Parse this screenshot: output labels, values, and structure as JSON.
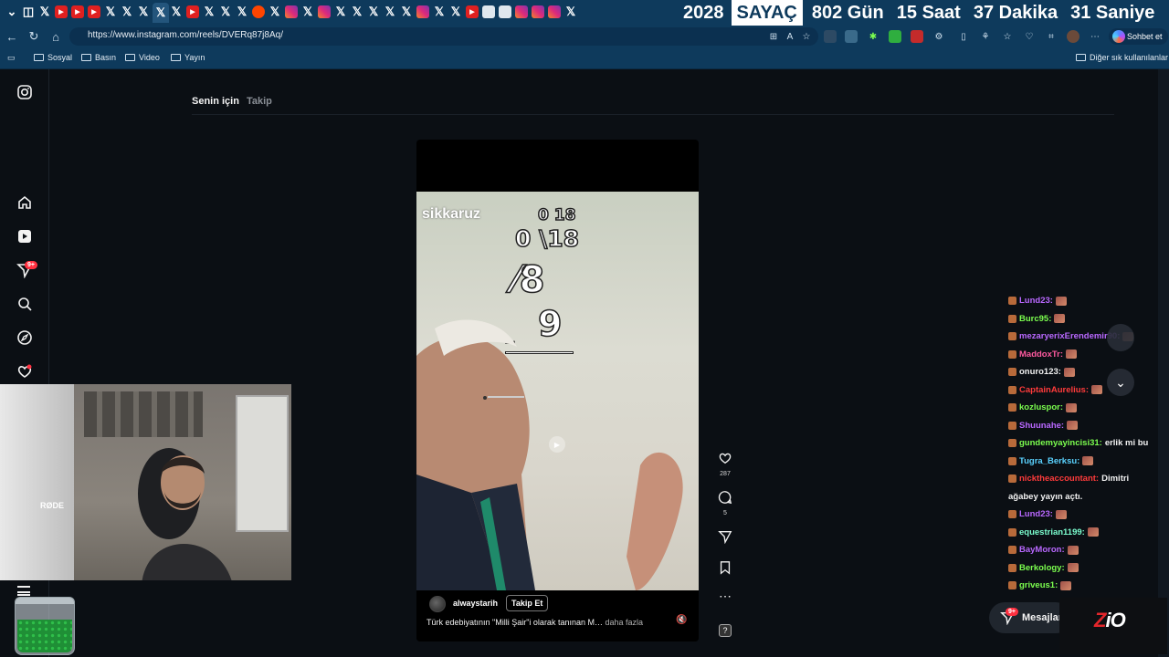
{
  "browser": {
    "tabs": [
      "chevron",
      "copilot",
      "x",
      "yt-alt",
      "yt",
      "yt",
      "x",
      "x",
      "x",
      "x-active",
      "x",
      "yt",
      "x",
      "x",
      "x",
      "reddit",
      "x",
      "ig",
      "x",
      "ig",
      "x",
      "x",
      "x",
      "x",
      "x",
      "ig",
      "x",
      "x",
      "yt",
      "doc",
      "doc",
      "ig",
      "ig",
      "ig",
      "x"
    ],
    "url": "https://www.instagram.com/reels/DVERq87j8Aq/",
    "copilot_label": "Sohbet et",
    "bookmarks": [
      "Sosyal",
      "Basın",
      "Video",
      "Yayın"
    ],
    "other_bookmarks": "Diğer sık kullanılanlar"
  },
  "counter": {
    "year": "2028",
    "title": "SAYAÇ",
    "days": "802 Gün",
    "hours": "15 Saat",
    "minutes": "37 Dakika",
    "seconds": "31 Saniye"
  },
  "instagram": {
    "feed_tabs": {
      "for_you": "Senin için",
      "following": "Takip"
    },
    "nav_badge": "9+",
    "reel": {
      "watermark": "sikkaruz",
      "overlay_lines": [
        "0 18",
        "0 \\18",
        "⁄8",
        "9",
        "_"
      ],
      "username": "alwaystarih",
      "follow_label": "Takip Et",
      "caption": "Türk edebiyatının \"Milli Şair\"i olarak tanınan M…",
      "more_label": "daha fazla",
      "likes": "287",
      "comments": "5"
    },
    "messages_label": "Mesajlar",
    "messages_badge": "9+"
  },
  "stream": {
    "cam_brand": "RØDE",
    "logo": {
      "z": "Z",
      "rest": "iO"
    }
  },
  "chat": [
    {
      "user": "Lund23:",
      "color": "#b968ff",
      "msg": ""
    },
    {
      "user": "Burc95:",
      "color": "#7cff4f",
      "msg": ""
    },
    {
      "user": "mezaryerixErendemir90:",
      "color": "#b968ff",
      "msg": ""
    },
    {
      "user": "MaddoxTr:",
      "color": "#ff5aa0",
      "msg": ""
    },
    {
      "user": "onuro123:",
      "color": "#f2f2f2",
      "msg": ""
    },
    {
      "user": "CaptainAurelius:",
      "color": "#ff3b3b",
      "msg": ""
    },
    {
      "user": "kozluspor:",
      "color": "#7cff4f",
      "msg": ""
    },
    {
      "user": "Shuunahe:",
      "color": "#b968ff",
      "msg": ""
    },
    {
      "user": "gundemyayincisi31:",
      "color": "#7cff4f",
      "msg": "erlik mi bu"
    },
    {
      "user": "Tugra_Berksu:",
      "color": "#5ad2ff",
      "msg": ""
    },
    {
      "user": "nicktheaccountant:",
      "color": "#ff3b3b",
      "msg": "Dimitri"
    },
    {
      "user": "",
      "color": "#f2f2f2",
      "msg": "ağabey yayın açtı."
    },
    {
      "user": "Lund23:",
      "color": "#b968ff",
      "msg": ""
    },
    {
      "user": "equestrian1199:",
      "color": "#7cffd0",
      "msg": ""
    },
    {
      "user": "BayMoron:",
      "color": "#b968ff",
      "msg": ""
    },
    {
      "user": "Berkology:",
      "color": "#7cff4f",
      "msg": ""
    },
    {
      "user": "griveus1:",
      "color": "#7cff4f",
      "msg": ""
    }
  ]
}
